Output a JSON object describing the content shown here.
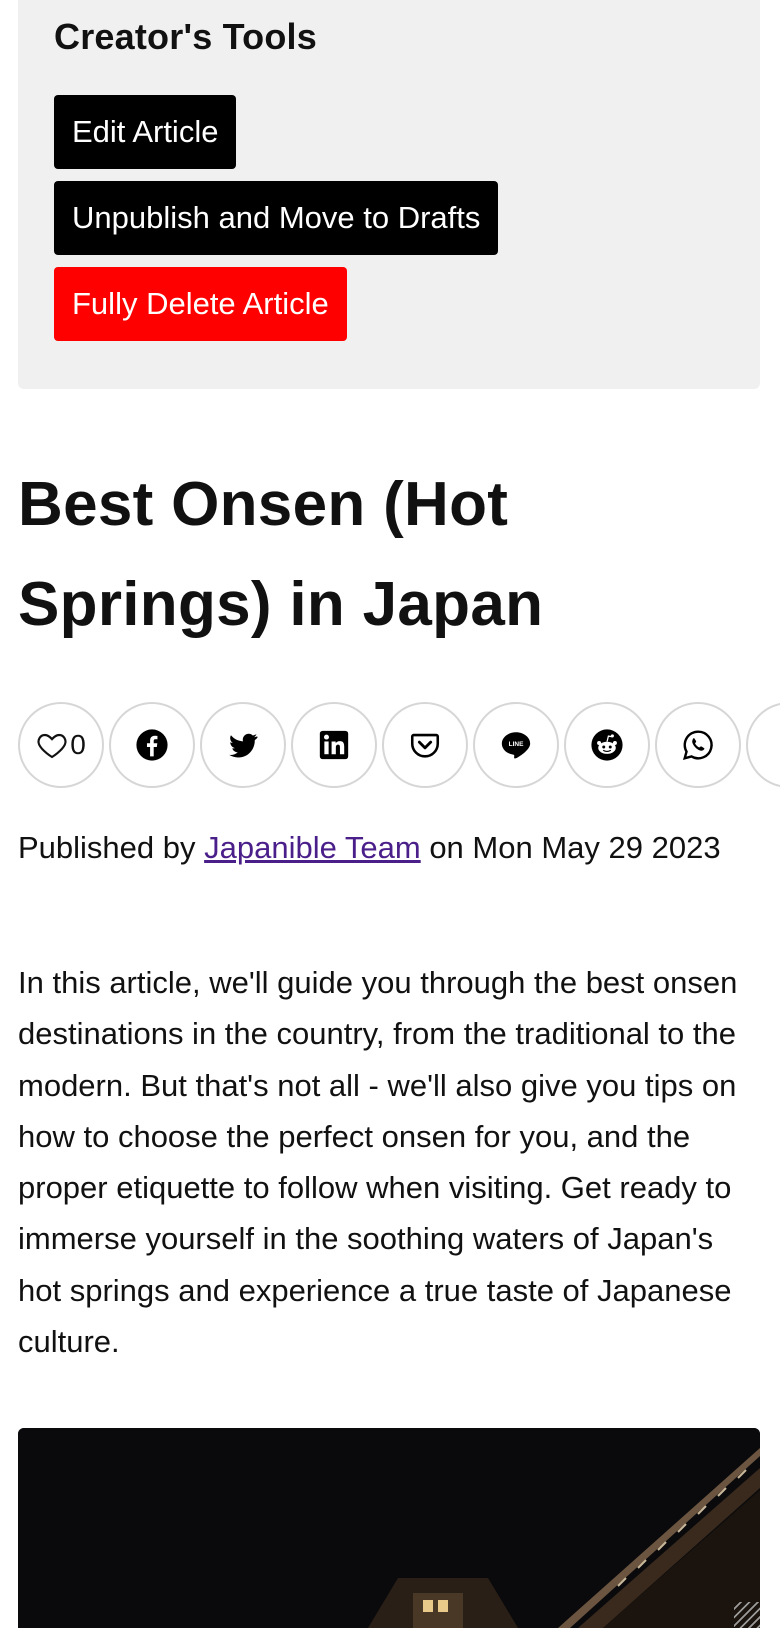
{
  "creator_tools": {
    "heading": "Creator's Tools",
    "edit_label": "Edit Article",
    "unpublish_label": "Unpublish and Move to Drafts",
    "delete_label": "Fully Delete Article"
  },
  "article": {
    "title": "Best Onsen (Hot Springs) in Japan",
    "likes": "0",
    "byline_prefix": "Published by ",
    "author": "Japanible Team",
    "byline_suffix": " on Mon May 29 2023",
    "intro": "In this article, we'll guide you through the best onsen destinations in the country, from the traditional to the modern. But that's not all - we'll also give you tips on how to choose the perfect onsen for you, and the proper etiquette to follow when visiting. Get ready to immerse yourself in the soothing waters of Japan's hot springs and experience a true taste of Japanese culture."
  },
  "share_buttons": [
    "heart-icon",
    "facebook-icon",
    "twitter-icon",
    "linkedin-icon",
    "pocket-icon",
    "line-icon",
    "reddit-icon",
    "whatsapp-icon"
  ],
  "colors": {
    "tools_bg": "#f0f0f0",
    "button_black": "#000000",
    "button_delete": "#ff0000",
    "link": "#4b1f8a"
  }
}
